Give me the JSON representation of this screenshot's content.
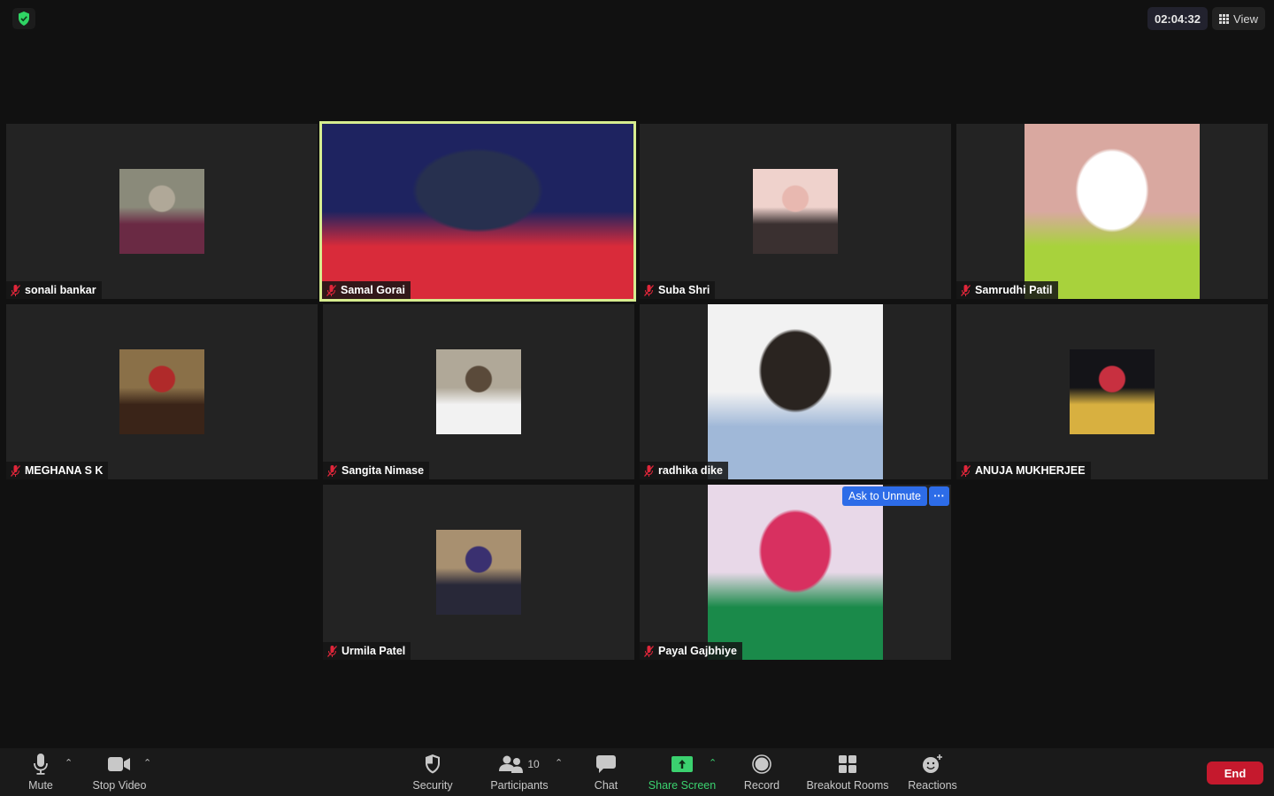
{
  "top_bar": {
    "security_icon": "shield-check-icon",
    "meeting_timer": "02:04:32",
    "view_label": "View",
    "view_icon": "grid-icon"
  },
  "participants": [
    {
      "name": "sonali bankar",
      "muted": true,
      "type": "avatar",
      "colors": [
        "#8a8a7a",
        "#6a2a44",
        "#b0a898"
      ]
    },
    {
      "name": "Samal Gorai",
      "muted": true,
      "type": "video",
      "active_speaker": true,
      "colors": [
        "#1e2360",
        "#d92b3a",
        "#27304f"
      ]
    },
    {
      "name": "Suba Shri",
      "muted": true,
      "type": "avatar",
      "colors": [
        "#efd2cc",
        "#3a3030",
        "#e8b8b0"
      ]
    },
    {
      "name": "Samrudhi Patil",
      "muted": true,
      "type": "video",
      "colors": [
        "#d9a8a0",
        "#a8d23c",
        "#ffffff"
      ]
    },
    {
      "name": "MEGHANA S K",
      "muted": true,
      "type": "avatar",
      "colors": [
        "#8a7048",
        "#3a2418",
        "#b02a2a"
      ]
    },
    {
      "name": "Sangita Nimase",
      "muted": true,
      "type": "avatar",
      "colors": [
        "#b0a898",
        "#f2f2f2",
        "#5a4a3a"
      ]
    },
    {
      "name": "radhika dike",
      "muted": true,
      "type": "video",
      "colors": [
        "#f2f2f2",
        "#a0b8d8",
        "#2a2420"
      ]
    },
    {
      "name": "ANUJA MUKHERJEE",
      "muted": true,
      "type": "avatar",
      "colors": [
        "#141418",
        "#d8b040",
        "#c83040"
      ]
    },
    {
      "name": "Urmila Patel",
      "muted": true,
      "type": "avatar",
      "colors": [
        "#a89070",
        "#282838",
        "#3a3070"
      ]
    },
    {
      "name": "Payal Gajbhiye",
      "muted": true,
      "type": "video",
      "colors": [
        "#e8d8e8",
        "#1a8a4a",
        "#d83060"
      ],
      "hover_actions": {
        "ask_to_unmute": "Ask to Unmute",
        "more": "···"
      }
    }
  ],
  "toolbar": {
    "mute": {
      "label": "Mute",
      "icon": "microphone-icon"
    },
    "stop_video": {
      "label": "Stop Video",
      "icon": "video-camera-icon"
    },
    "security": {
      "label": "Security",
      "icon": "shield-icon"
    },
    "participants": {
      "label": "Participants",
      "icon": "participants-icon",
      "count": "10"
    },
    "chat": {
      "label": "Chat",
      "icon": "chat-bubble-icon"
    },
    "share_screen": {
      "label": "Share Screen",
      "icon": "share-screen-icon",
      "color": "#3bd16f"
    },
    "record": {
      "label": "Record",
      "icon": "record-icon"
    },
    "breakout_rooms": {
      "label": "Breakout Rooms",
      "icon": "breakout-rooms-icon"
    },
    "reactions": {
      "label": "Reactions",
      "icon": "reactions-icon"
    },
    "end": {
      "label": "End",
      "color": "#c5192d"
    }
  },
  "colors": {
    "active_speaker_border": "#d6ec8f",
    "ask_unmute_bg": "#2d6ce8",
    "muted_icon": "#e0263a"
  }
}
